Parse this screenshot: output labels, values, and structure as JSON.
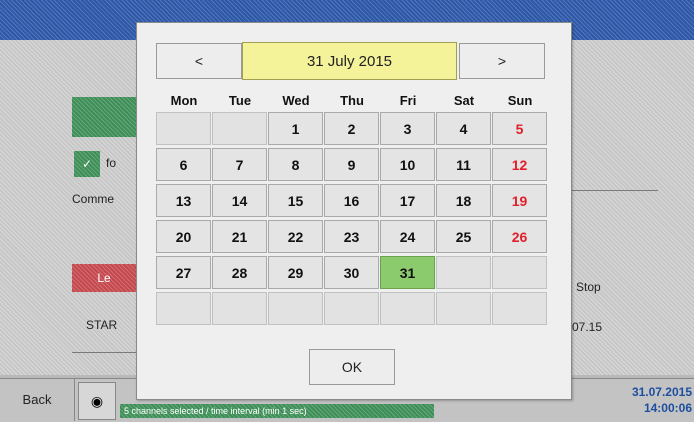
{
  "background": {
    "comment_label": "Comme",
    "start_label": "STAR",
    "stop_label": "Stop",
    "date_fragment": "07.15",
    "fo_label": "fo",
    "le_label": "Le",
    "status_text": "5 channels selected / time interval (min 1 sec)",
    "back_label": "Back",
    "date": "31.07.2015",
    "time": "14:00:06"
  },
  "calendar": {
    "prev_label": "<",
    "next_label": ">",
    "month_label": "31 July 2015",
    "weekdays": [
      "Mon",
      "Tue",
      "Wed",
      "Thu",
      "Fri",
      "Sat",
      "Sun"
    ],
    "weeks": [
      [
        "",
        "",
        "1",
        "2",
        "3",
        "4",
        "5"
      ],
      [
        "6",
        "7",
        "8",
        "9",
        "10",
        "11",
        "12"
      ],
      [
        "13",
        "14",
        "15",
        "16",
        "17",
        "18",
        "19"
      ],
      [
        "20",
        "21",
        "22",
        "23",
        "24",
        "25",
        "26"
      ],
      [
        "27",
        "28",
        "29",
        "30",
        "31",
        "",
        ""
      ],
      [
        "",
        "",
        "",
        "",
        "",
        "",
        ""
      ]
    ],
    "selected_day": "31",
    "sunday_color": "#e0202a",
    "selected_color": "#8ccb6d",
    "ok_label": "OK"
  }
}
